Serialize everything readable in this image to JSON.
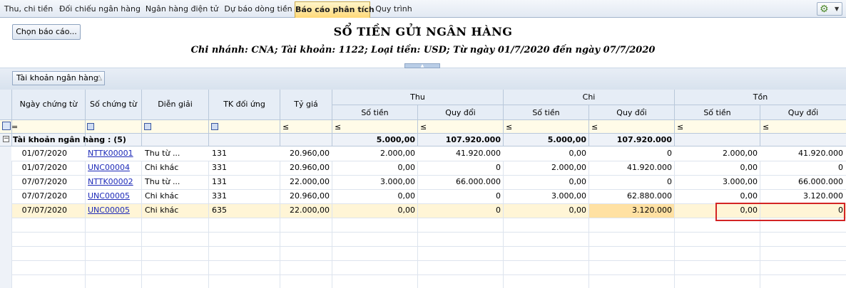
{
  "tabs": [
    {
      "label": "Thu, chi tiền",
      "active": false
    },
    {
      "label": "Đối chiếu ngân hàng",
      "active": false
    },
    {
      "label": "Ngân hàng điện tử",
      "active": false
    },
    {
      "label": "Dự báo dòng tiền",
      "active": false
    },
    {
      "label": "Báo cáo phân tích",
      "active": true
    },
    {
      "label": "Quy trình",
      "active": false
    }
  ],
  "toolbar": {
    "choose_report_label": "Chọn báo cáo..."
  },
  "report": {
    "title": "SỔ TIỀN GỬI NGÂN HÀNG",
    "subtitle": "Chi nhánh: CNA; Tài khoản: 1122; Loại tiền: USD; Từ ngày 01/7/2020 đến ngày 07/7/2020"
  },
  "group_panel": {
    "chip_label": "Tài khoản ngân hàng"
  },
  "grid": {
    "headers": {
      "date": "Ngày chứng từ",
      "doc_no": "Số chứng từ",
      "desc": "Diễn giải",
      "acct": "TK đối ứng",
      "rate": "Tỷ giá",
      "thu": "Thu",
      "chi": "Chi",
      "ton": "Tồn",
      "amount": "Số tiền",
      "converted": "Quy đổi"
    },
    "filter": {
      "eq": "=",
      "le": "≤"
    },
    "group_row": {
      "label": "Tài khoản ngân hàng : (5)",
      "thu_amount": "5.000,00",
      "thu_converted": "107.920.000",
      "chi_amount": "5.000,00",
      "chi_converted": "107.920.000"
    },
    "rows": [
      {
        "date": "01/07/2020",
        "doc_no": "NTTK00001",
        "desc": "Thu từ ...",
        "acct": "131",
        "rate": "20.960,00",
        "thu_amount": "2.000,00",
        "thu_converted": "41.920.000",
        "chi_amount": "0,00",
        "chi_converted": "0",
        "ton_amount": "2.000,00",
        "ton_converted": "41.920.000"
      },
      {
        "date": "01/07/2020",
        "doc_no": "UNC00004",
        "desc": "Chi khác",
        "acct": "331",
        "rate": "20.960,00",
        "thu_amount": "0,00",
        "thu_converted": "0",
        "chi_amount": "2.000,00",
        "chi_converted": "41.920.000",
        "ton_amount": "0,00",
        "ton_converted": "0"
      },
      {
        "date": "07/07/2020",
        "doc_no": "NTTK00002",
        "desc": "Thu từ ...",
        "acct": "131",
        "rate": "22.000,00",
        "thu_amount": "3.000,00",
        "thu_converted": "66.000.000",
        "chi_amount": "0,00",
        "chi_converted": "0",
        "ton_amount": "3.000,00",
        "ton_converted": "66.000.000"
      },
      {
        "date": "07/07/2020",
        "doc_no": "UNC00005",
        "desc": "Chi khác",
        "acct": "331",
        "rate": "20.960,00",
        "thu_amount": "0,00",
        "thu_converted": "0",
        "chi_amount": "3.000,00",
        "chi_converted": "62.880.000",
        "ton_amount": "0,00",
        "ton_converted": "3.120.000"
      },
      {
        "date": "07/07/2020",
        "doc_no": "UNC00005",
        "desc": "Chi khác",
        "acct": "635",
        "rate": "22.000,00",
        "thu_amount": "0,00",
        "thu_converted": "0",
        "chi_amount": "0,00",
        "chi_converted": "3.120.000",
        "ton_amount": "0,00",
        "ton_converted": "0"
      }
    ]
  },
  "colors": {
    "selected_row": "#fff5d6",
    "focus_cell": "#ffe1a3",
    "highlight_box": "#d32424",
    "grid_header": "#e6edf6"
  }
}
